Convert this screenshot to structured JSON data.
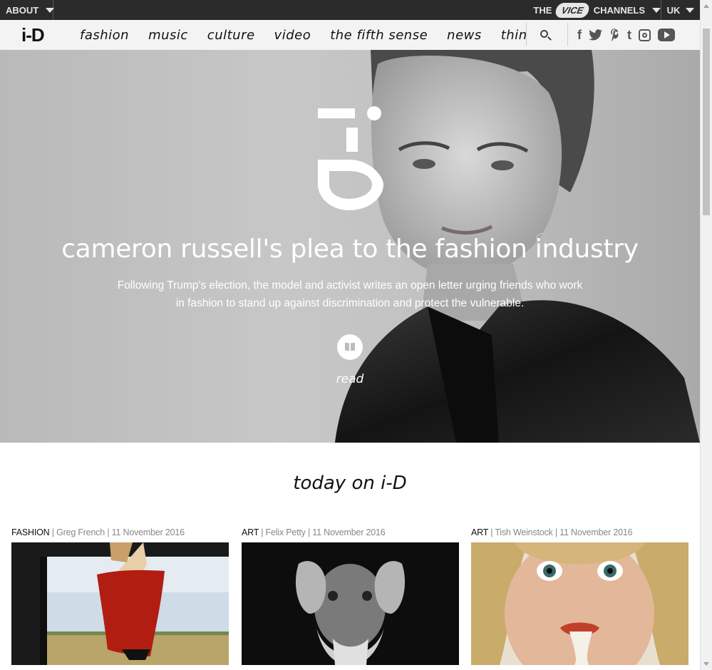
{
  "topbar": {
    "about_label": "ABOUT",
    "channels_prefix": "THE",
    "channels_brand": "VICE",
    "channels_suffix": "CHANNELS",
    "region_label": "UK"
  },
  "nav": {
    "logo": "i-D",
    "links": [
      "fashion",
      "music",
      "culture",
      "video",
      "the fifth sense",
      "news",
      "think pie"
    ],
    "social": [
      "facebook",
      "twitter",
      "pinterest",
      "tumblr",
      "instagram",
      "youtube"
    ]
  },
  "hero": {
    "title": "cameron russell's plea to the fashion industry",
    "description": "Following Trump's election, the model and activist writes an open letter urging friends who work in fashion to stand up against discrimination and protect the vulnerable.",
    "read_label": "read"
  },
  "today": {
    "heading": "today on i-D",
    "cards": [
      {
        "category": "FASHION",
        "author": "Greg French",
        "date": "11 November 2016"
      },
      {
        "category": "ART",
        "author": "Felix Petty",
        "date": "11 November 2016"
      },
      {
        "category": "ART",
        "author": "Tish Weinstock",
        "date": "11 November 2016"
      }
    ]
  },
  "colors": {
    "topbar_bg": "#2b2b2b",
    "nav_bg": "#f3f3f3",
    "text": "#111111",
    "meta": "#888888"
  }
}
